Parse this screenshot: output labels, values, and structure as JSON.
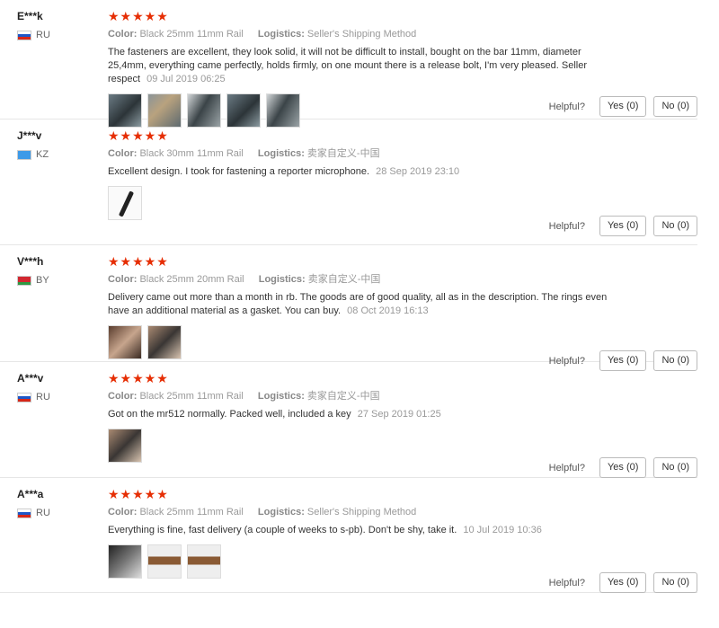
{
  "labels": {
    "color": "Color:",
    "logistics": "Logistics:",
    "helpful": "Helpful?"
  },
  "colors": {
    "star": "#e62e04"
  },
  "reviews": [
    {
      "name": "E***k",
      "country": "RU",
      "flag": "russia-flag",
      "stars": "★★★★★",
      "rating": 5,
      "color": "Black 25mm 11mm Rail",
      "logistics": "Seller's Shipping Method",
      "text": "The fasteners are excellent, they look solid, it will not be difficult to install, bought on the bar 11mm, diameter 25,4mm, everything came perfectly, holds firmly, on one mount there is a release bolt, I'm very pleased. Seller respect",
      "date": "09 Jul 2019 06:25",
      "yes": "Yes (0)",
      "no": "No (0)",
      "photos": [
        "t-dark",
        "t-rings",
        "t-scope",
        "t-dark",
        "t-scope"
      ]
    },
    {
      "name": "J***v",
      "country": "KZ",
      "flag": "kazakhstan-flag",
      "stars": "★★★★★",
      "rating": 5,
      "color": "Black 30mm 11mm Rail",
      "logistics": "卖家自定义-中国",
      "text": "Excellent design. I took for fastening a reporter microphone.",
      "date": "28 Sep 2019 23:10",
      "yes": "Yes (0)",
      "no": "No (0)",
      "photos": [
        "t-mic"
      ]
    },
    {
      "name": "V***h",
      "country": "BY",
      "flag": "belarus-flag",
      "stars": "★★★★★",
      "rating": 5,
      "color": "Black 25mm 20mm Rail",
      "logistics": "卖家自定义-中国",
      "text": "Delivery came out more than a month in rb. The goods are of good quality, all as in the description. The rings even have an additional material as a gasket. You can buy.",
      "date": "08 Oct 2019 16:13",
      "yes": "Yes (0)",
      "no": "No (0)",
      "photos": [
        "t-hand",
        "t-hand2"
      ]
    },
    {
      "name": "A***v",
      "country": "RU",
      "flag": "russia-flag",
      "stars": "★★★★★",
      "rating": 5,
      "color": "Black 25mm 11mm Rail",
      "logistics": "卖家自定义-中国",
      "text": "Got on the mr512 normally. Packed well, included a key",
      "date": "27 Sep 2019 01:25",
      "yes": "Yes (0)",
      "no": "No (0)",
      "photos": [
        "t-hand2"
      ]
    },
    {
      "name": "A***a",
      "country": "RU",
      "flag": "russia-flag",
      "stars": "★★★★★",
      "rating": 5,
      "color": "Black 25mm 11mm Rail",
      "logistics": "Seller's Shipping Method",
      "text": "Everything is fine, fast delivery (a couple of weeks to s-pb). Don't be shy, take it.",
      "date": "10 Jul 2019 10:36",
      "yes": "Yes (0)",
      "no": "No (0)",
      "photos": [
        "t-bw",
        "t-wood",
        "t-wood"
      ]
    }
  ]
}
